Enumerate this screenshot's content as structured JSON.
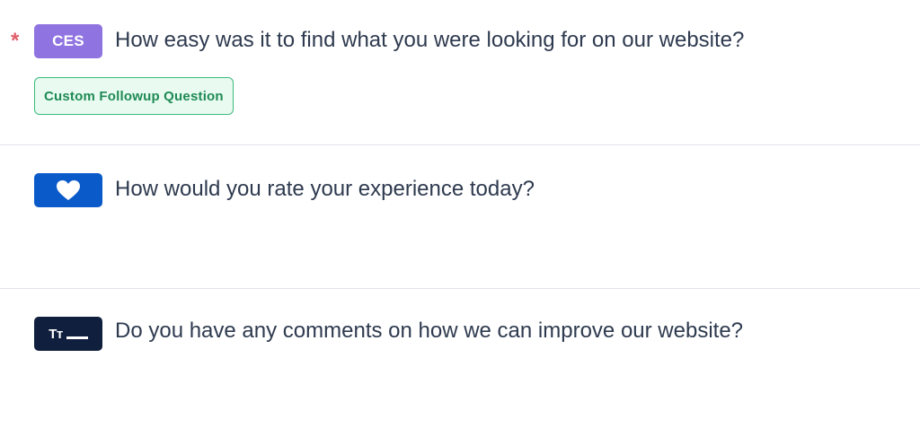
{
  "questions": [
    {
      "required_marker": "*",
      "type_badge_label": "CES",
      "type_icon": "ces-label-badge",
      "text": "How easy was it to find what you were looking for on our website?",
      "tag_label": "Custom Followup Question"
    },
    {
      "type_icon": "heart-icon",
      "text": "How would you rate your experience today?"
    },
    {
      "type_icon": "text-field-icon",
      "type_icon_glyph": "Tт",
      "text": "Do you have any comments on how we can improve our website?"
    }
  ],
  "colors": {
    "ces_badge": "#8f73e0",
    "rating_badge": "#0b5ac9",
    "text_badge": "#0f1f3d",
    "required_star": "#e05d6a",
    "followup_border": "#3cba7c",
    "followup_bg": "#e9fbf1",
    "followup_text": "#1f8a55"
  }
}
